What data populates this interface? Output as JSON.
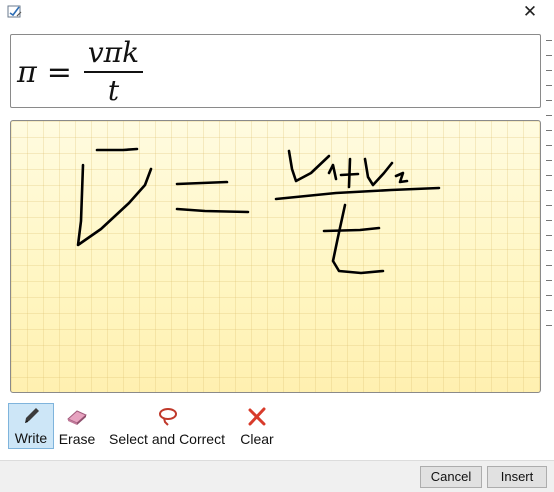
{
  "dialog": {
    "close_label": "✕"
  },
  "preview": {
    "lhs": "π",
    "equals": "=",
    "numerator": "vπk",
    "denominator": "t"
  },
  "tools": [
    {
      "label": "Write",
      "icon": "pen-icon",
      "selected": true
    },
    {
      "label": "Erase",
      "icon": "eraser-icon",
      "selected": false
    },
    {
      "label": "Select and Correct",
      "icon": "lasso-icon",
      "selected": false
    },
    {
      "label": "Clear",
      "icon": "clear-x-icon",
      "selected": false
    }
  ],
  "buttons": {
    "cancel": "Cancel",
    "insert": "Insert"
  },
  "colors": {
    "ink": "#000000",
    "pad_background": "#fff6c2",
    "selected_tool": "#cde6f7",
    "clear_icon": "#d83b2b"
  }
}
